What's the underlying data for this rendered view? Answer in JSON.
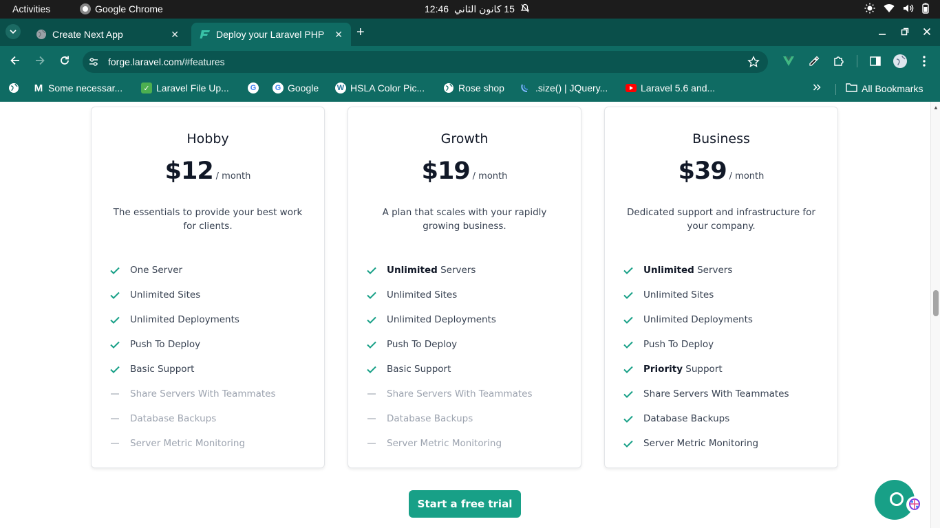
{
  "system_bar": {
    "activities": "Activities",
    "app_name": "Google Chrome",
    "time": "12:46",
    "date": "15 كانون الثاني"
  },
  "tabs": [
    {
      "title": "Create Next App",
      "active": false,
      "icon": "globe-icon"
    },
    {
      "title": "Deploy your Laravel PHP",
      "active": true,
      "icon": "forge-logo-icon"
    }
  ],
  "address_bar": {
    "host": "forge.laravel.com",
    "path": "/#features"
  },
  "bookmarks": [
    {
      "label": "Some necessar...",
      "icon": "gmail-icon"
    },
    {
      "label": "Laravel File Up...",
      "icon": "bookmark-favicon"
    },
    {
      "label": "",
      "icon": "google-icon"
    },
    {
      "label": "Google",
      "icon": "google-icon"
    },
    {
      "label": "HSLA Color Pic...",
      "icon": "wordpress-icon"
    },
    {
      "label": "Rose shop",
      "icon": "globe-icon"
    },
    {
      "label": ".size() | JQuery...",
      "icon": "jquery-icon"
    },
    {
      "label": "Laravel 5.6 and...",
      "icon": "youtube-icon"
    }
  ],
  "all_bookmarks": "All Bookmarks",
  "plans": [
    {
      "name": "Hobby",
      "price": "$12",
      "period": "/ month",
      "description": "The essentials to provide your best work for clients.",
      "features": [
        {
          "bold": "",
          "text": "One Server",
          "included": true
        },
        {
          "bold": "",
          "text": "Unlimited Sites",
          "included": true
        },
        {
          "bold": "",
          "text": "Unlimited Deployments",
          "included": true
        },
        {
          "bold": "",
          "text": "Push To Deploy",
          "included": true
        },
        {
          "bold": "",
          "text": "Basic Support",
          "included": true
        },
        {
          "bold": "",
          "text": "Share Servers With Teammates",
          "included": false
        },
        {
          "bold": "",
          "text": "Database Backups",
          "included": false
        },
        {
          "bold": "",
          "text": "Server Metric Monitoring",
          "included": false
        }
      ]
    },
    {
      "name": "Growth",
      "price": "$19",
      "period": "/ month",
      "description": "A plan that scales with your rapidly growing business.",
      "features": [
        {
          "bold": "Unlimited",
          "text": " Servers",
          "included": true
        },
        {
          "bold": "",
          "text": "Unlimited Sites",
          "included": true
        },
        {
          "bold": "",
          "text": "Unlimited Deployments",
          "included": true
        },
        {
          "bold": "",
          "text": "Push To Deploy",
          "included": true
        },
        {
          "bold": "",
          "text": "Basic Support",
          "included": true
        },
        {
          "bold": "",
          "text": "Share Servers With Teammates",
          "included": false
        },
        {
          "bold": "",
          "text": "Database Backups",
          "included": false
        },
        {
          "bold": "",
          "text": "Server Metric Monitoring",
          "included": false
        }
      ]
    },
    {
      "name": "Business",
      "price": "$39",
      "period": "/ month",
      "description": "Dedicated support and infrastructure for your company.",
      "features": [
        {
          "bold": "Unlimited",
          "text": " Servers",
          "included": true
        },
        {
          "bold": "",
          "text": "Unlimited Sites",
          "included": true
        },
        {
          "bold": "",
          "text": "Unlimited Deployments",
          "included": true
        },
        {
          "bold": "",
          "text": "Push To Deploy",
          "included": true
        },
        {
          "bold": "Priority",
          "text": " Support",
          "included": true
        },
        {
          "bold": "",
          "text": "Share Servers With Teammates",
          "included": true
        },
        {
          "bold": "",
          "text": "Database Backups",
          "included": true
        },
        {
          "bold": "",
          "text": "Server Metric Monitoring",
          "included": true
        }
      ]
    }
  ],
  "cta_label": "Start a free trial",
  "colors": {
    "accent": "#18a087",
    "chrome_frame": "#0a4f4a",
    "chrome_toolbar": "#0f6b63"
  }
}
